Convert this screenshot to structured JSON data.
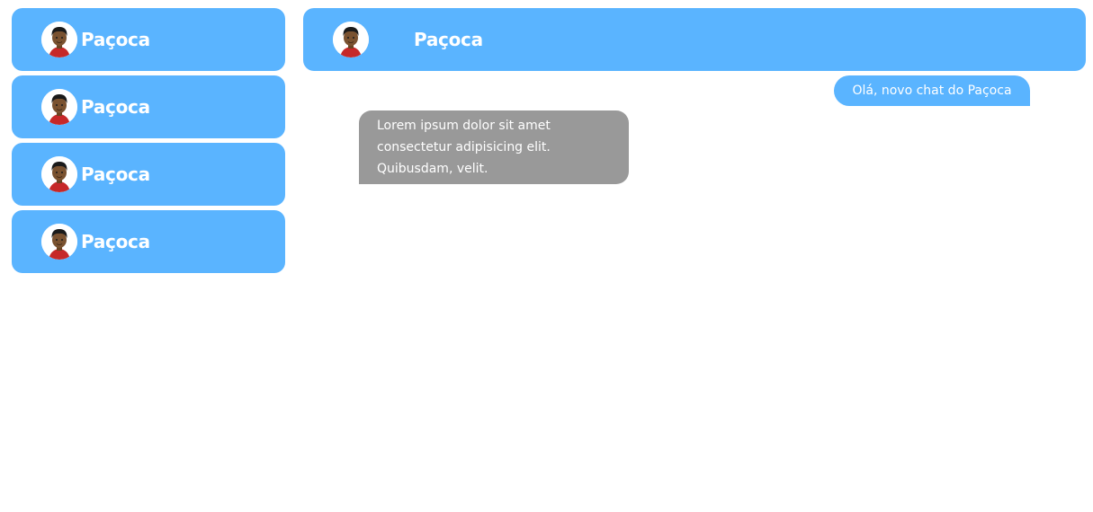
{
  "colors": {
    "accent": "#5ab4ff",
    "incoming_bubble": "#999999",
    "text_on_accent": "#ffffff"
  },
  "sidebar": {
    "contacts": [
      {
        "name": "Paçoca",
        "avatar_icon": "boy-avatar-icon"
      },
      {
        "name": "Paçoca",
        "avatar_icon": "boy-avatar-icon"
      },
      {
        "name": "Paçoca",
        "avatar_icon": "boy-avatar-icon"
      },
      {
        "name": "Paçoca",
        "avatar_icon": "boy-avatar-icon"
      }
    ]
  },
  "chat": {
    "header": {
      "name": "Paçoca",
      "avatar_icon": "boy-avatar-icon"
    },
    "messages": [
      {
        "direction": "outgoing",
        "text": "Olá, novo chat do Paçoca"
      },
      {
        "direction": "incoming",
        "text": "Lorem ipsum dolor sit amet consectetur adipisicing elit. Quibusdam, velit."
      }
    ]
  }
}
